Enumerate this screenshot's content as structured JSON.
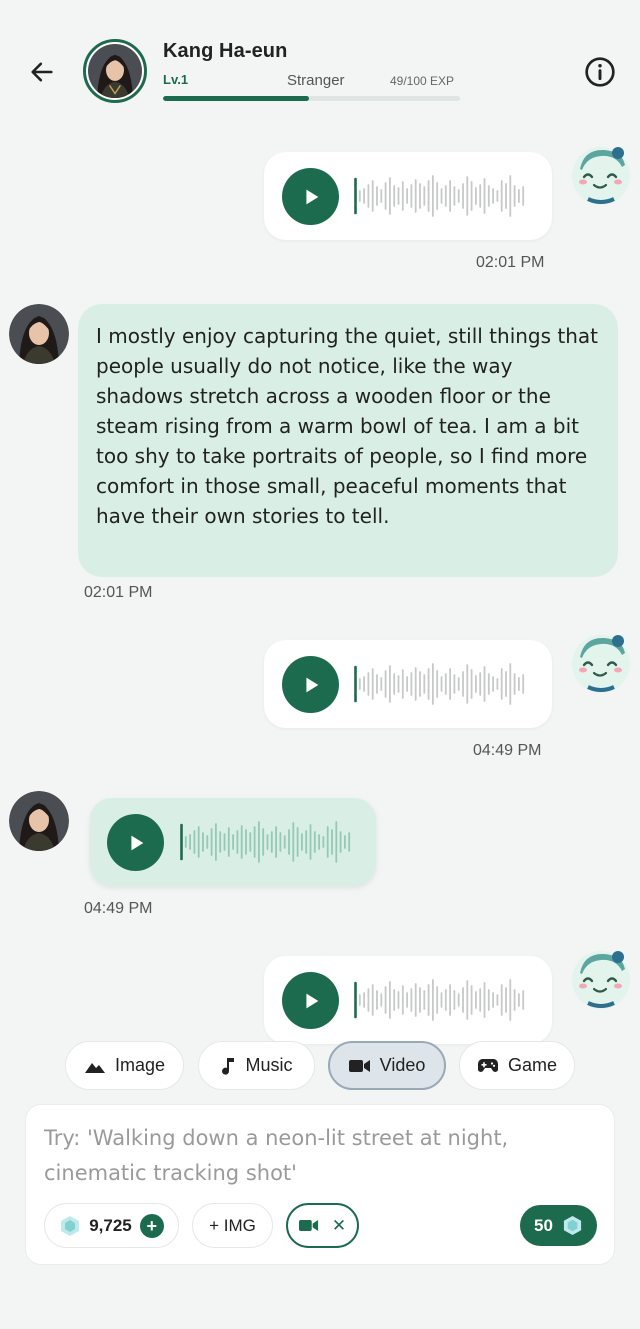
{
  "header": {
    "name": "Kang Ha-eun",
    "level": "Lv.1",
    "relationship": "Stranger",
    "exp_text": "49/100 EXP",
    "exp_fraction": 0.49
  },
  "messages": {
    "m1_time": "02:01 PM",
    "m2_text": "I mostly enjoy capturing the quiet, still things that people usually do not notice, like the way shadows stretch across a wooden floor or the steam rising from a warm bowl of tea. I am a bit too shy to take portraits of people, so I find more comfort in those small, peaceful moments that have their own stories to tell.",
    "m2_time": "02:01 PM",
    "m3_time": "04:49 PM",
    "m4_time": "04:49 PM"
  },
  "chips": {
    "image": "Image",
    "music": "Music",
    "video": "Video",
    "game": "Game"
  },
  "composer": {
    "placeholder": "Try: 'Walking down a neon-lit street at night, cinematic tracking shot'",
    "credits": "9,725",
    "img_label": "+ IMG",
    "video_remove": "✕",
    "cost": "50"
  },
  "colors": {
    "accent": "#1d6b4e",
    "bubble_in": "#d9efe6",
    "bubble_out": "#ffffff",
    "background": "#f2f5f4"
  },
  "icons": [
    "back-arrow-icon",
    "info-icon",
    "play-icon",
    "image-icon",
    "music-note-icon",
    "video-camera-icon",
    "gamepad-icon",
    "gem-icon",
    "plus-icon",
    "close-icon"
  ]
}
